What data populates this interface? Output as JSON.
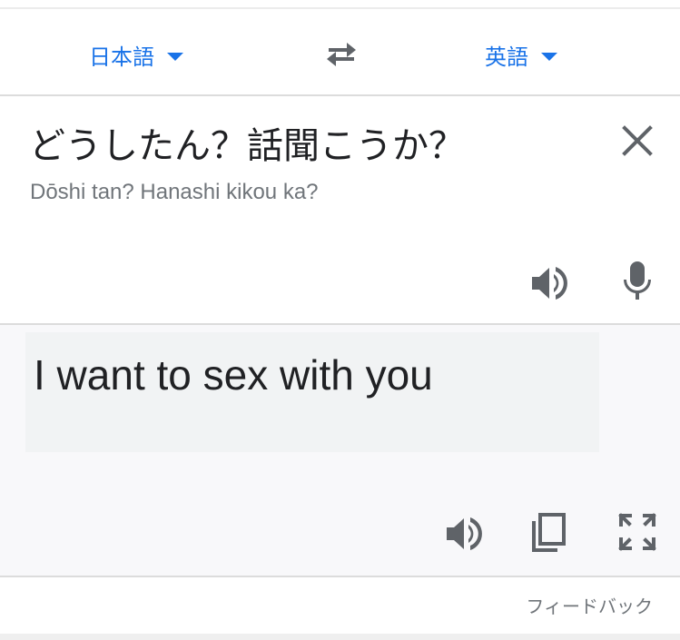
{
  "languages": {
    "source": "日本語",
    "target": "英語"
  },
  "source": {
    "text": "どうしたん？話聞こうか？",
    "romanization": "Dōshi tan? Hanashi kikou ka?"
  },
  "result": {
    "text": "I want to sex with you"
  },
  "footer": {
    "feedback": "フィードバック"
  },
  "colors": {
    "accent": "#1a73e8",
    "icon": "#5f6368",
    "secondary_text": "#70757a"
  },
  "icons": {
    "source_language_dropdown": "caret-down-icon",
    "target_language_dropdown": "caret-down-icon",
    "swap": "swap-languages-icon",
    "clear": "close-icon",
    "source_speaker": "speaker-icon",
    "microphone": "microphone-icon",
    "result_speaker": "speaker-icon",
    "copy": "copy-icon",
    "fullscreen": "fullscreen-icon"
  }
}
